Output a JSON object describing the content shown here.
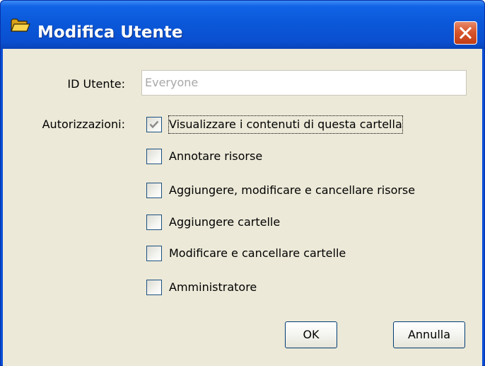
{
  "window": {
    "title": "Modifica Utente"
  },
  "form": {
    "user_id_label": "ID Utente:",
    "user_id_value": "Everyone",
    "permissions_label": "Autorizzazioni:"
  },
  "permissions": [
    {
      "label": "Visualizzare i contenuti di questa cartella",
      "checked": true
    },
    {
      "label": "Annotare risorse",
      "checked": false
    },
    {
      "label": "Aggiungere, modificare e cancellare risorse",
      "checked": false
    },
    {
      "label": "Aggiungere cartelle",
      "checked": false
    },
    {
      "label": "Modificare e cancellare cartelle",
      "checked": false
    },
    {
      "label": "Amministratore",
      "checked": false
    }
  ],
  "buttons": {
    "ok_label": "OK",
    "cancel_label": "Annulla"
  },
  "icons": {
    "title": "folder-icon",
    "close": "close-icon",
    "check": "check-icon"
  },
  "colors": {
    "titlebar": "#0a57d8",
    "close_button": "#d9562c",
    "dialog_background": "#ece9d8",
    "checkbox_border": "#1c5180",
    "check_mark": "#8a8a8a",
    "disabled_text": "#a8a8a8"
  }
}
